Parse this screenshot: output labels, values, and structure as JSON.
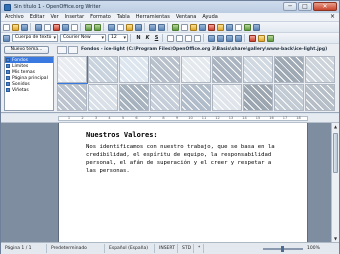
{
  "window": {
    "title": "Sin título 1 - OpenOffice.org Writer",
    "minimize": "─",
    "maximize": "□",
    "close": "✕"
  },
  "menubar": {
    "items": [
      "Archivo",
      "Editar",
      "Ver",
      "Insertar",
      "Formato",
      "Tabla",
      "Herramientas",
      "Ventana",
      "Ayuda"
    ],
    "close_glyph": "×"
  },
  "format_toolbar": {
    "style": "Cuerpo de texto",
    "font": "Courier New",
    "size": "12",
    "bold": "N",
    "italic": "K",
    "underline": "S"
  },
  "gallery": {
    "new_theme_button": "Nuevo tema...",
    "themes": [
      "Fondos",
      "Límites",
      "Mis temas",
      "Página principal",
      "Sonidos",
      "Viñetas"
    ],
    "selected_theme_index": 0,
    "path": "Fondos - ice-light (C:\\Program Files\\OpenOffice.org 3\\Basis\\share\\gallery\\www-back\\ice-light.jpg)",
    "thumbnail_colors": [
      "#e9edf1",
      "#c9d3de",
      "#dde6ef",
      "#b8c1cb",
      "#e4e9ee",
      "#aab4c0",
      "#d0d8e1",
      "#9fa9b4",
      "#ccd3db",
      "#bcc5cf",
      "#d9e0e8",
      "#a7b2bf",
      "#c6cfd9",
      "#b1bccb",
      "#dfe5eb",
      "#9ca6b1",
      "#c2cad3",
      "#b6bec8"
    ]
  },
  "ruler": {
    "ticks": [
      "1",
      "2",
      "3",
      "4",
      "5",
      "6",
      "7",
      "8",
      "9",
      "10",
      "11",
      "12",
      "13",
      "14",
      "15",
      "16",
      "17",
      "18"
    ]
  },
  "document": {
    "heading": "Nuestros Valores:",
    "body": "Nos identificamos con nuestro trabajo, que se basa en la credibilidad, el espíritu de equipo, la responsabilidad personal, el afán de superación y el creer y respetar a las personas."
  },
  "statusbar": {
    "page": "Página 1 / 1",
    "style": "Predeterminado",
    "language": "Español (España)",
    "mode": "INSERT",
    "selection": "STD",
    "signature": "*",
    "zoom": "100%"
  }
}
